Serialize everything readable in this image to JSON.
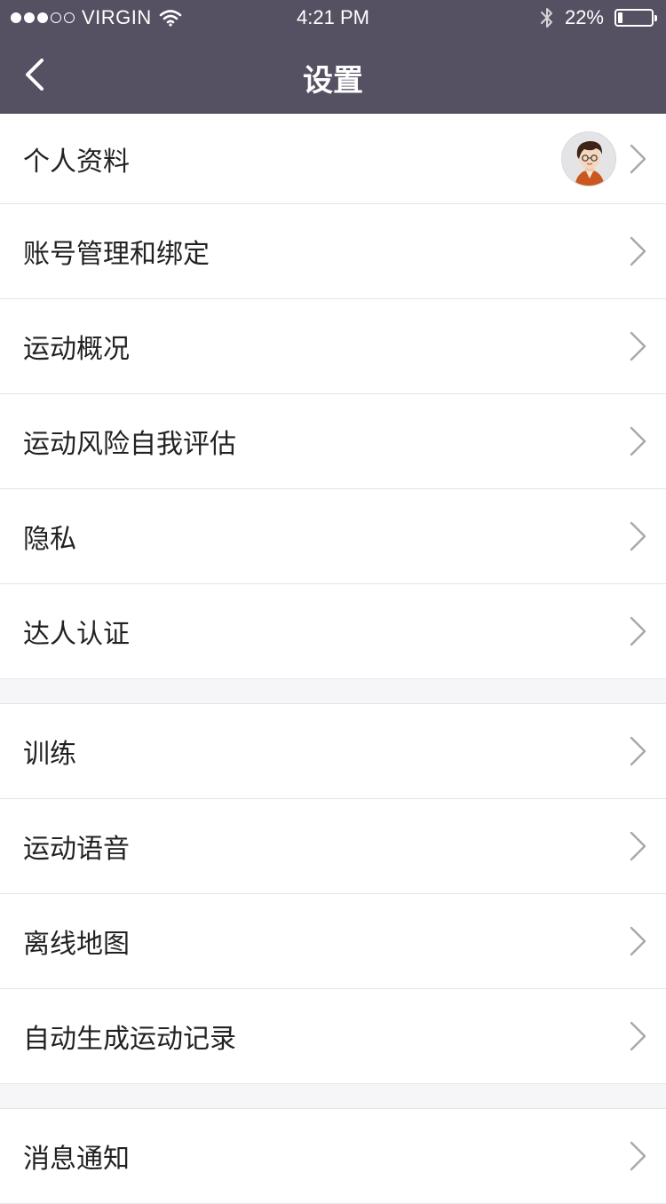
{
  "status_bar": {
    "carrier": "VIRGIN",
    "time": "4:21 PM",
    "battery": "22%",
    "battery_level": 0.22,
    "signal_strength": 3,
    "signal_total": 5,
    "icons": [
      "wifi-icon",
      "bluetooth-icon",
      "battery-icon"
    ]
  },
  "nav": {
    "title": "设置",
    "back_icon": "chevron-left-icon"
  },
  "sections": [
    {
      "items": [
        {
          "label": "个人资料",
          "has_avatar": true
        },
        {
          "label": "账号管理和绑定"
        },
        {
          "label": "运动概况"
        },
        {
          "label": "运动风险自我评估"
        },
        {
          "label": "隐私"
        },
        {
          "label": "达人认证"
        }
      ]
    },
    {
      "items": [
        {
          "label": "训练"
        },
        {
          "label": "运动语音"
        },
        {
          "label": "离线地图"
        },
        {
          "label": "自动生成运动记录"
        }
      ]
    },
    {
      "items": [
        {
          "label": "消息通知"
        }
      ]
    }
  ],
  "colors": {
    "nav_background": "#565063",
    "text": "#222222",
    "chevron": "#a7a7ad",
    "separator": "#e3e3e6"
  }
}
